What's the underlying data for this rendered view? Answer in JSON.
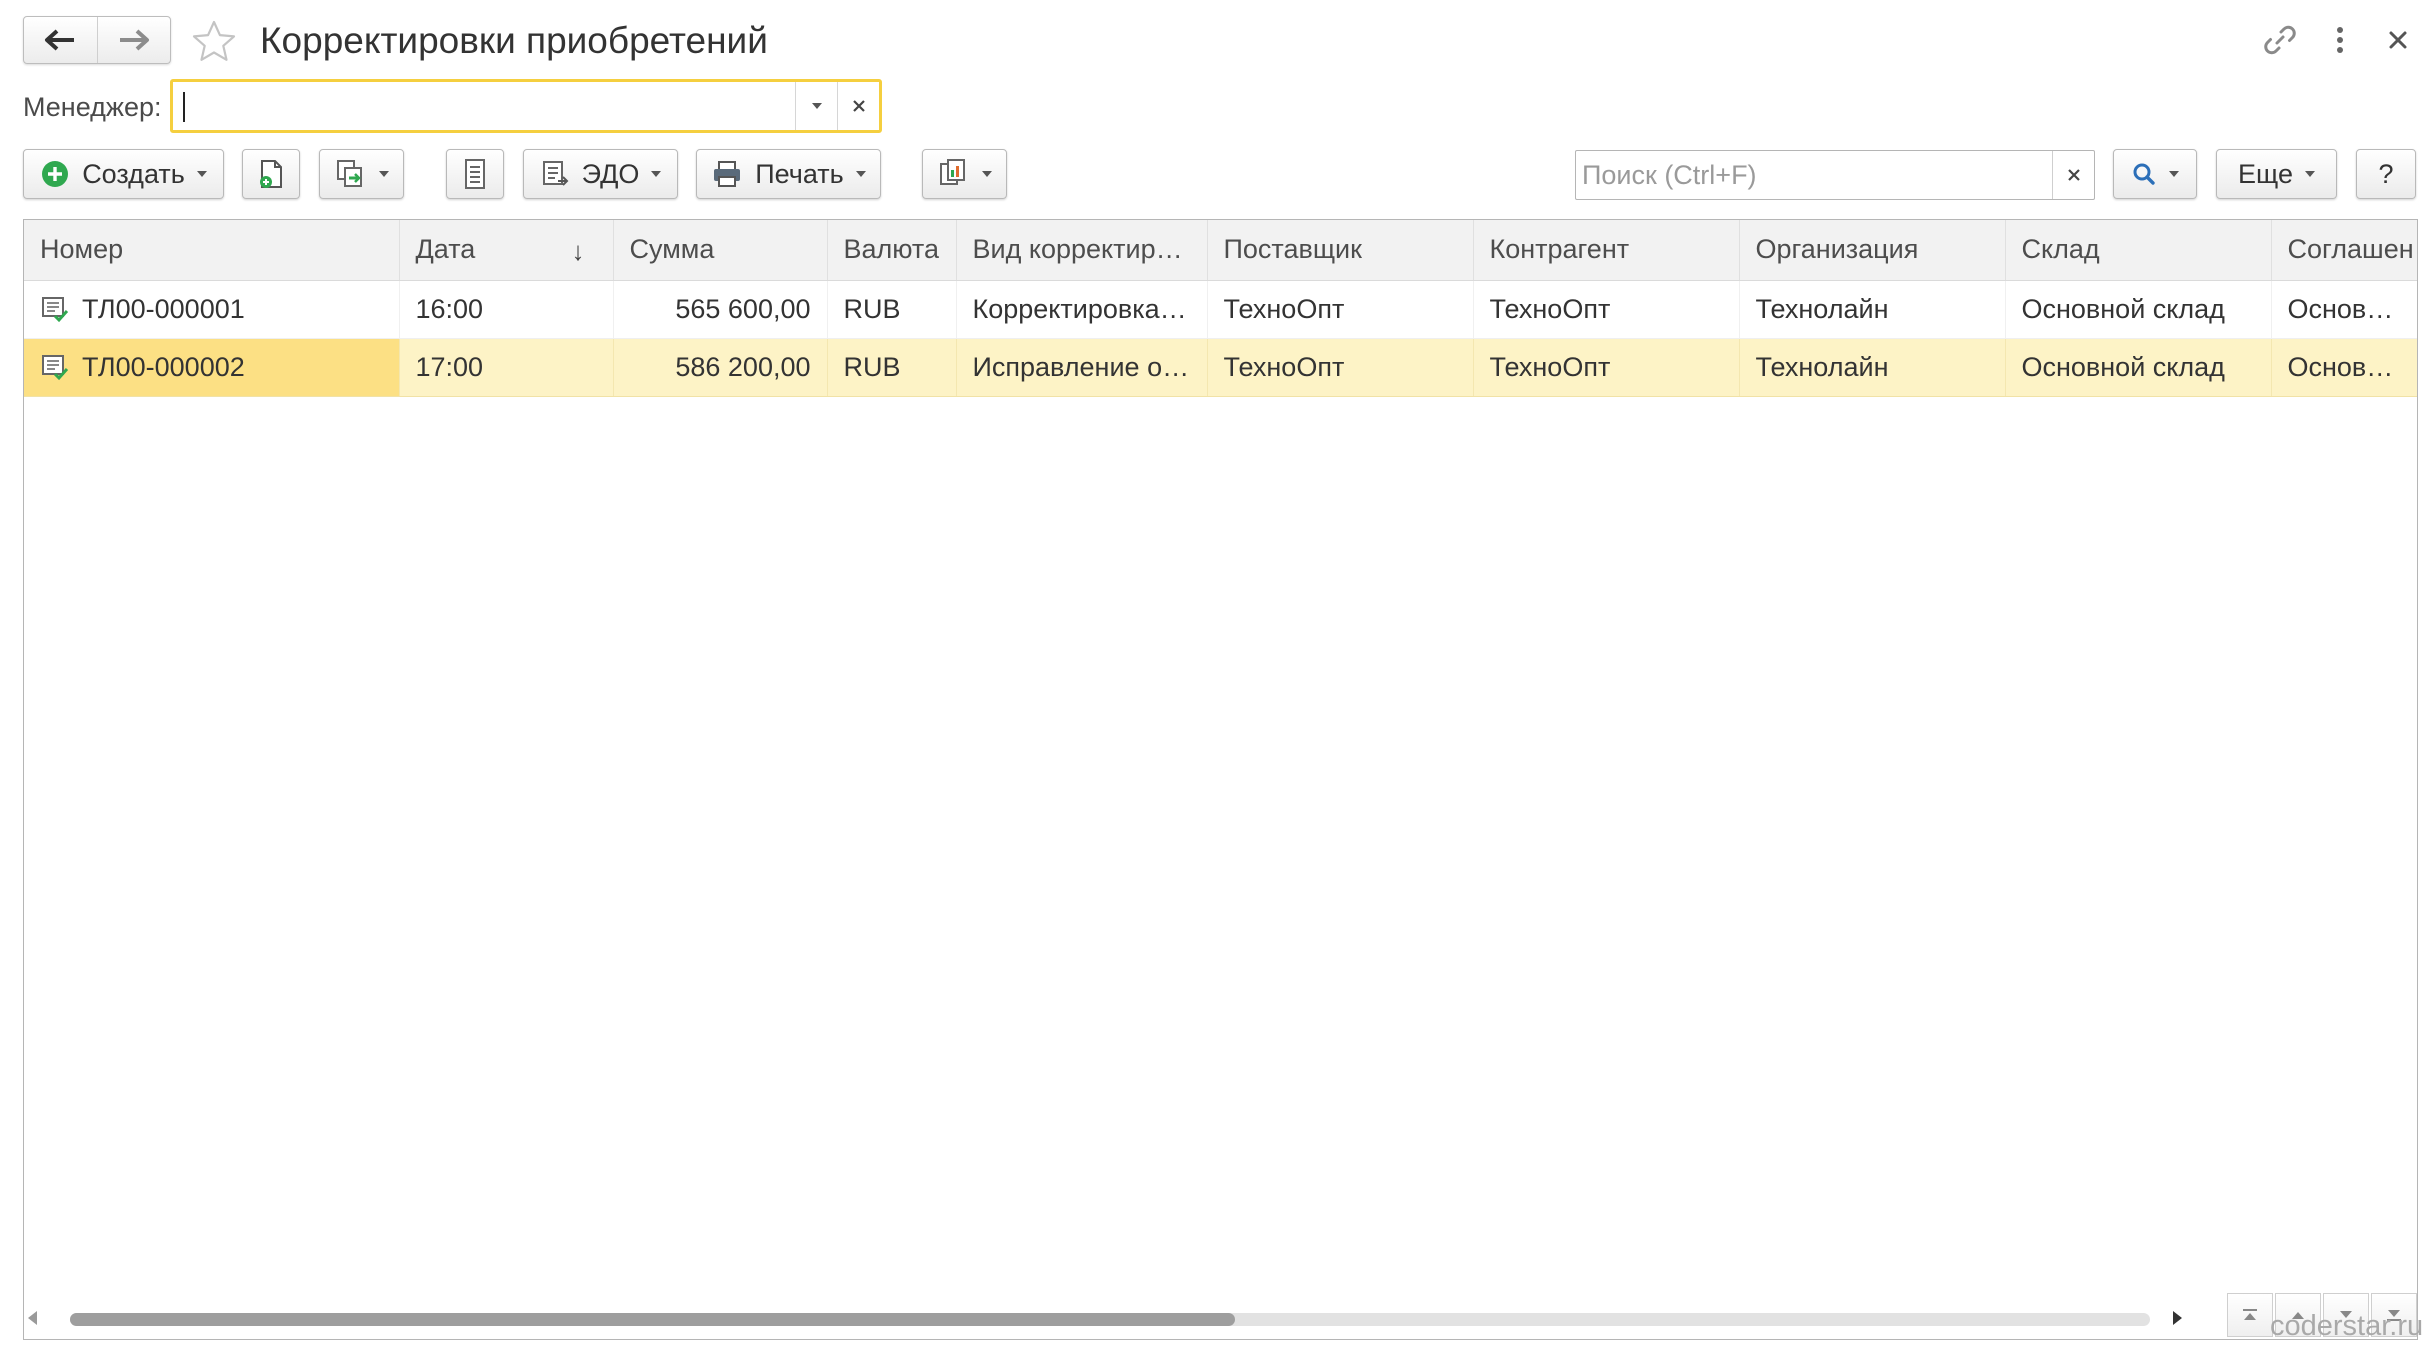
{
  "window": {
    "title": "Корректировки приобретений"
  },
  "filter": {
    "manager_label": "Менеджер:",
    "manager_value": ""
  },
  "toolbar": {
    "create_label": "Создать",
    "edo_label": "ЭДО",
    "print_label": "Печать",
    "search_placeholder": "Поиск (Ctrl+F)",
    "more_label": "Еще",
    "help_label": "?"
  },
  "table": {
    "columns": [
      "Номер",
      "Дата",
      "Сумма",
      "Валюта",
      "Вид корректир…",
      "Поставщик",
      "Контрагент",
      "Организация",
      "Склад",
      "Соглашен"
    ],
    "sort_indicator": "↓",
    "rows": [
      {
        "number": "ТЛ00-000001",
        "date": "16:00",
        "sum": "565 600,00",
        "currency": "RUB",
        "kind": "Корректировка…",
        "supplier": "ТехноОпт",
        "counterparty": "ТехноОпт",
        "organization": "Технолайн",
        "warehouse": "Основной склад",
        "agreement": "Основные",
        "selected": false
      },
      {
        "number": "ТЛ00-000002",
        "date": "17:00",
        "sum": "586 200,00",
        "currency": "RUB",
        "kind": "Исправление о…",
        "supplier": "ТехноОпт",
        "counterparty": "ТехноОпт",
        "organization": "Технолайн",
        "warehouse": "Основной склад",
        "agreement": "Основные",
        "selected": true
      }
    ]
  },
  "scroll": {
    "horizontal_position": 0.0,
    "visible_fraction": 0.56
  },
  "watermark": "coderstar.ru",
  "colors": {
    "focus_border": "#f5cf3f",
    "selected_row": "#fdf3c6",
    "current_cell": "#fce084",
    "create_icon": "#2fa84f",
    "header_bg": "#f2f2f2"
  }
}
